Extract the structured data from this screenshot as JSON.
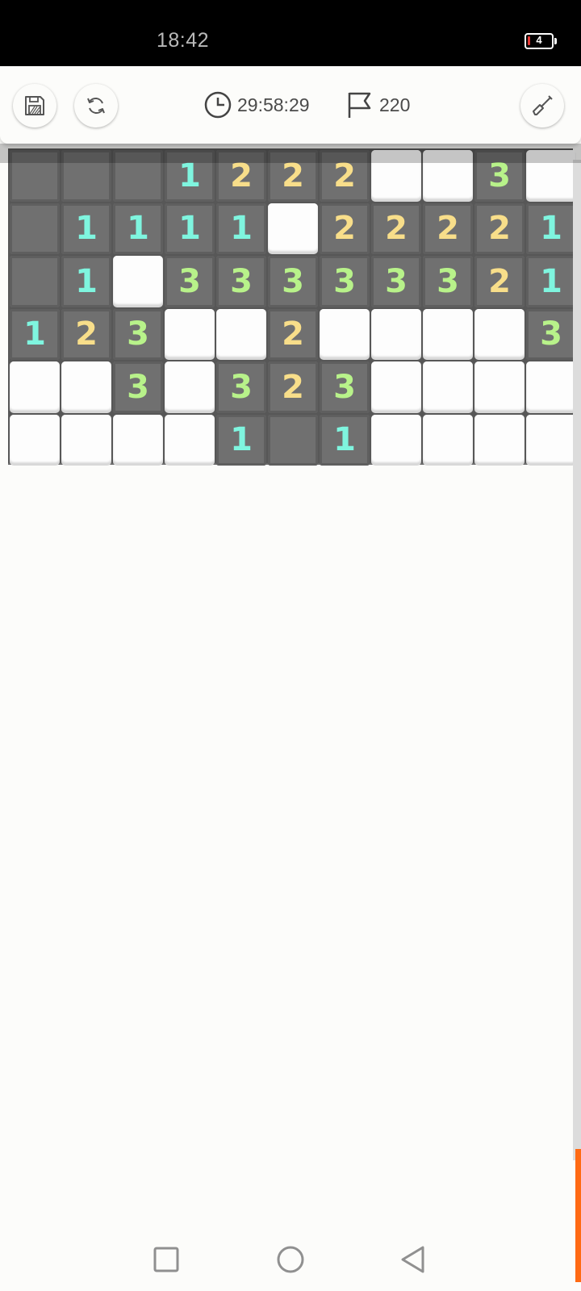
{
  "status_bar": {
    "time": "18:42",
    "battery_level": "4"
  },
  "toolbar": {
    "save_icon": "floppy-disk-icon",
    "restart_icon": "refresh-icon",
    "timer_icon": "clock-icon",
    "timer": "29:58:29",
    "flag_icon": "flag-icon",
    "flags": "220",
    "tool_icon": "shovel-icon"
  },
  "number_colors": {
    "1": "#7ff5df",
    "2": "#f8de8a",
    "3": "#b8f28a"
  },
  "board": {
    "columns": 11,
    "rows": [
      [
        "R",
        "R",
        "R",
        "1",
        "2",
        "2",
        "2",
        "H",
        "H",
        "3",
        "H"
      ],
      [
        "R",
        "1",
        "1",
        "1",
        "1",
        "H",
        "2",
        "2",
        "2",
        "2",
        "1"
      ],
      [
        "R",
        "1",
        "H",
        "3",
        "3",
        "3",
        "3",
        "3",
        "3",
        "2",
        "1"
      ],
      [
        "1",
        "2",
        "3",
        "H",
        "H",
        "2",
        "H",
        "H",
        "H",
        "H",
        "3"
      ],
      [
        "H",
        "H",
        "3",
        "H",
        "3",
        "2",
        "3",
        "H",
        "H",
        "H",
        "H"
      ],
      [
        "H",
        "H",
        "H",
        "H",
        "1",
        "R",
        "1",
        "H",
        "H",
        "H",
        "H"
      ]
    ]
  },
  "nav_bar": {
    "recents_icon": "square-icon",
    "home_icon": "circle-icon",
    "back_icon": "triangle-back-icon"
  }
}
